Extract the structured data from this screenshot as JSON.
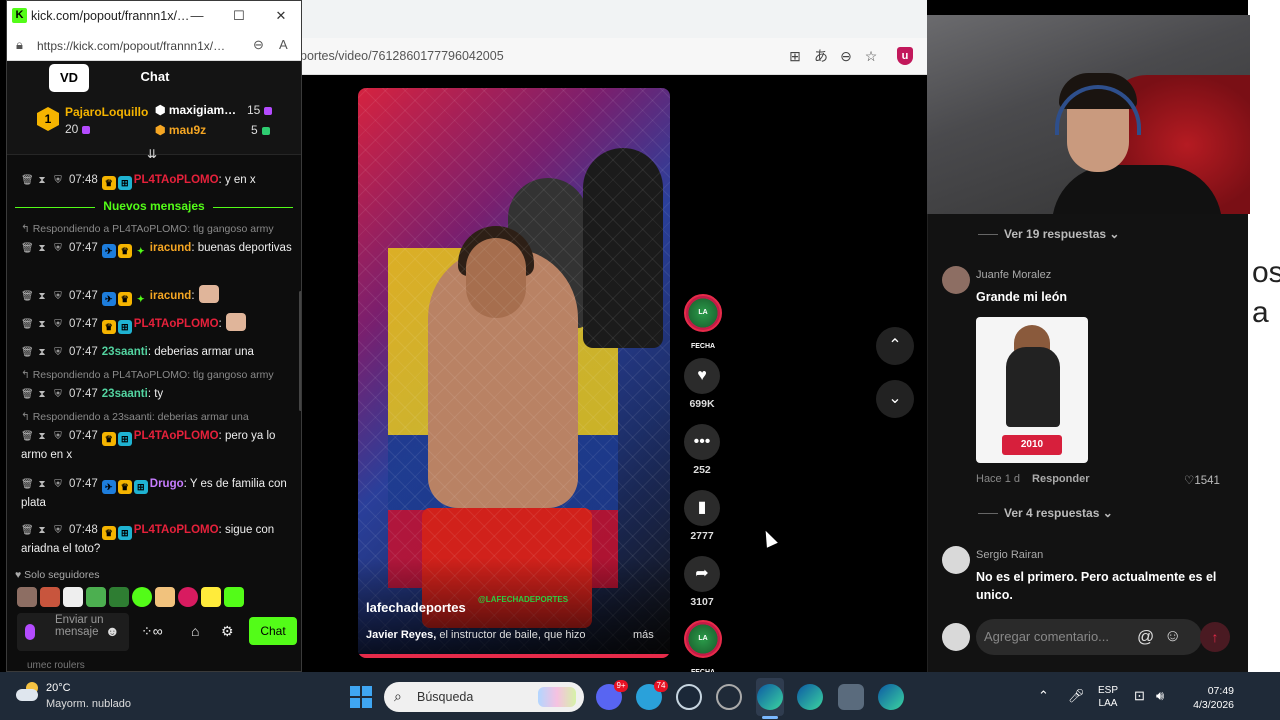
{
  "popout": {
    "window_title": "kick.com/popout/frannn1x/…",
    "url": "https://kick.com/popout/frannn1x/…",
    "chat_title": "Chat",
    "logo_text": "VD",
    "leaderboard": [
      {
        "rank": "1",
        "name": "PajaroLoquillo",
        "value": "20"
      },
      {
        "name": "maxigiam…",
        "value": "15"
      },
      {
        "name": "mau9z",
        "value": "5"
      }
    ],
    "new_messages_label": "Nuevos mensajes",
    "messages": [
      {
        "time": "07:48",
        "user": "PL4TAoPLOMO",
        "text": "y en x"
      },
      {
        "reply": "Respondiendo a PL4TAoPLOMO: tlg gangoso army"
      },
      {
        "time": "07:47",
        "user": "iracund",
        "text": "buenas deportivas"
      },
      {
        "time": "07:47",
        "user": "iracund",
        "text": ""
      },
      {
        "time": "07:47",
        "user": "PL4TAoPLOMO",
        "text": ""
      },
      {
        "time": "07:47",
        "user": "23saanti",
        "text": "deberias armar una"
      },
      {
        "reply": "Respondiendo a PL4TAoPLOMO: tlg gangoso army"
      },
      {
        "time": "07:47",
        "user": "23saanti",
        "text": "ty"
      },
      {
        "reply": "Respondiendo a 23saanti: deberias armar una"
      },
      {
        "time": "07:47",
        "user": "PL4TAoPLOMO",
        "text": "pero ya lo armo en x"
      },
      {
        "time": "07:47",
        "user": "Drugo",
        "text": "Y es de familia con plata"
      },
      {
        "time": "07:48",
        "user": "PL4TAoPLOMO",
        "text": "sigue con ariadna el toto?"
      }
    ],
    "followers_only": "Solo seguidores",
    "input_placeholder": "Enviar un mensaje",
    "send_label": "Chat",
    "cut_username": "umec roulers"
  },
  "browser": {
    "url_tail": "portes/video/7612860177796042005"
  },
  "video": {
    "author": "lafechadeportes",
    "watermark": "@LAFECHADEPORTES",
    "caption_bold": "Javier Reyes,",
    "caption_rest": "el instructor de baile, que hizo",
    "more": "más",
    "avatar_text": "LA FECHA",
    "likes": "699K",
    "comments": "252",
    "saves": "2777",
    "shares": "3107"
  },
  "comments": {
    "view_replies_1": "Ver 19 respuestas",
    "c1_name": "Juanfe Moralez",
    "c1_text": "Grande mi león",
    "c1_image_badge": "2010",
    "c1_time": "Hace 1 d",
    "c1_reply": "Responder",
    "c1_likes": "1541",
    "view_replies_2": "Ver 4 respuestas",
    "c2_name": "Sergio Rairan",
    "c2_text": "No es el primero. Pero actualmente es el unico.",
    "input_placeholder": "Agregar comentario..."
  },
  "bg_text": [
    "os",
    "a"
  ],
  "taskbar": {
    "temperature": "20°C",
    "weather": "Mayorm. nublado",
    "search": "Búsqueda",
    "badge_1": "9+",
    "badge_2": "74",
    "lang_1": "ESP",
    "lang_2": "LAA",
    "time": "07:49",
    "date": "4/3/2026"
  },
  "colors": {
    "kick_green": "#53fc18",
    "tiktok_red": "#e62b4a",
    "taskbar": "#1f2a38"
  }
}
